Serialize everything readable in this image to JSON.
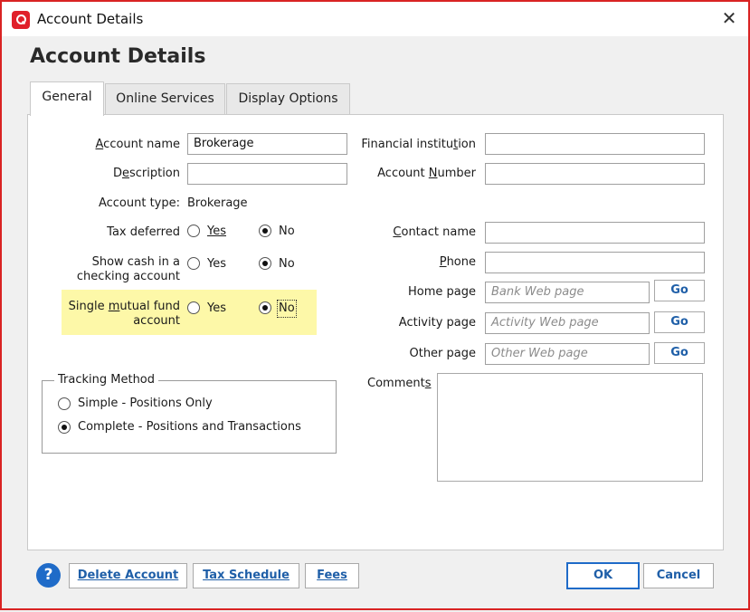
{
  "window": {
    "title": "Account Details",
    "close_glyph": "✕"
  },
  "page": {
    "heading": "Account Details"
  },
  "tabs": [
    {
      "label": "General",
      "active": true
    },
    {
      "label": "Online Services",
      "active": false
    },
    {
      "label": "Display Options",
      "active": false
    }
  ],
  "left_fields": {
    "account_name": {
      "label_pre": "",
      "label_ul": "A",
      "label_post": "ccount name",
      "value": "Brokerage"
    },
    "description": {
      "label_pre": "D",
      "label_ul": "e",
      "label_post": "scription",
      "value": ""
    },
    "account_type": {
      "label": "Account type:",
      "value": "Brokerage"
    },
    "tax_deferred": {
      "label": "Tax deferred",
      "yes": "Yes",
      "no": "No",
      "selected": "No"
    },
    "show_cash": {
      "label_line1": "Show cash in a",
      "label_line2": "checking account",
      "yes": "Yes",
      "no": "No",
      "selected": "No"
    },
    "single_mutual_fund": {
      "label_pre": "Single ",
      "label_ul": "m",
      "label_post": "utual fund",
      "label_line2": "account",
      "yes": "Yes",
      "no": "No",
      "selected": "No"
    }
  },
  "tracking_method": {
    "title": "Tracking Method",
    "options": [
      {
        "label": "Simple - Positions Only",
        "selected": false
      },
      {
        "label": "Complete - Positions and Transactions",
        "selected": true
      }
    ]
  },
  "right_fields": {
    "financial_institution": {
      "label_pre": "Financial institu",
      "label_ul": "t",
      "label_post": "ion",
      "value": ""
    },
    "account_number": {
      "label_pre": "Account ",
      "label_ul": "N",
      "label_post": "umber",
      "value": ""
    },
    "contact_name": {
      "label_pre": "",
      "label_ul": "C",
      "label_post": "ontact name",
      "value": ""
    },
    "phone": {
      "label_pre": "",
      "label_ul": "P",
      "label_post": "hone",
      "value": ""
    },
    "home_page": {
      "label": "Home page",
      "placeholder": "Bank Web page",
      "go": "Go"
    },
    "activity_page": {
      "label": "Activity page",
      "placeholder": "Activity Web page",
      "go": "Go"
    },
    "other_page": {
      "label": "Other page",
      "placeholder": "Other Web page",
      "go": "Go"
    },
    "comments": {
      "label_pre": "Comment",
      "label_ul": "s",
      "label_post": ""
    }
  },
  "footer": {
    "help_glyph": "?",
    "delete_account": "Delete Account",
    "tax_schedule": "Tax Schedule",
    "fees": "Fees",
    "ok": "OK",
    "cancel": "Cancel"
  },
  "colors": {
    "frame_border": "#d92323",
    "highlight": "#fdf8a8",
    "link_blue": "#1f5fa8",
    "help_blue": "#1f6bc8"
  },
  "icons": {
    "app": "quicken-logo-icon",
    "close": "close-icon",
    "help": "help-icon"
  }
}
